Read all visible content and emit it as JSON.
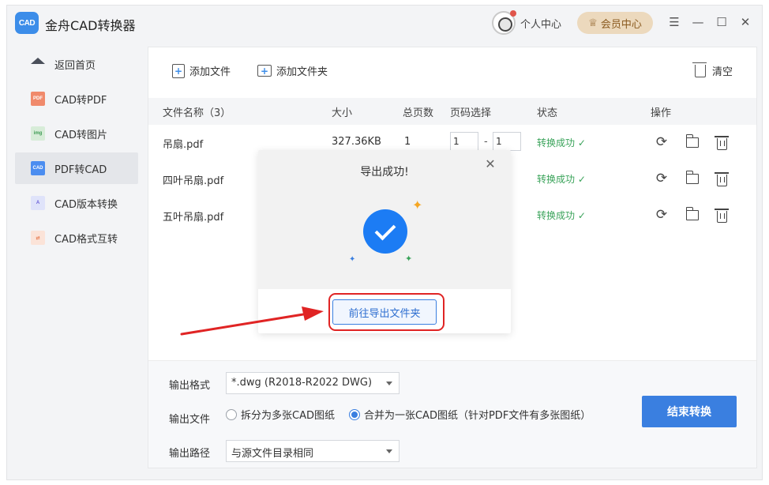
{
  "app": {
    "title": "金舟CAD转换器",
    "logo_text": "CAD",
    "user_center": "个人中心",
    "vip": "会员中心",
    "controls": {
      "menu": "☰",
      "minimize": "—",
      "maximize": "☐",
      "close": "✕"
    }
  },
  "sidebar": {
    "items": [
      {
        "label": "返回首页",
        "icon": "home-icon",
        "badge": ""
      },
      {
        "label": "CAD转PDF",
        "icon": "pdf-icon",
        "badge": "PDF"
      },
      {
        "label": "CAD转图片",
        "icon": "image-icon",
        "badge": "img"
      },
      {
        "label": "PDF转CAD",
        "icon": "cad-icon",
        "badge": "CAD"
      },
      {
        "label": "CAD版本转换",
        "icon": "version-icon",
        "badge": "A"
      },
      {
        "label": "CAD格式互转",
        "icon": "format-icon",
        "badge": "⇄"
      }
    ],
    "active_index": 3
  },
  "toolbar": {
    "add_file": "添加文件",
    "add_folder": "添加文件夹",
    "clear": "清空"
  },
  "table": {
    "headers": {
      "name": "文件名称（3）",
      "size": "大小",
      "pages": "总页数",
      "page_select": "页码选择",
      "status": "状态",
      "ops": "操作"
    },
    "rows": [
      {
        "name": "吊扇.pdf",
        "size": "327.36KB",
        "pages": "1",
        "from": "1",
        "to": "1",
        "status": "转换成功 ✓"
      },
      {
        "name": "四叶吊扇.pdf",
        "size": "",
        "pages": "",
        "from": "",
        "to": "",
        "status": "转换成功 ✓"
      },
      {
        "name": "五叶吊扇.pdf",
        "size": "",
        "pages": "",
        "from": "",
        "to": "",
        "status": "转换成功 ✓"
      }
    ],
    "dash": "-"
  },
  "settings": {
    "format_label": "输出格式",
    "format_value": "*.dwg (R2018-R2022 DWG)",
    "file_label": "输出文件",
    "option_split": "拆分为多张CAD图纸",
    "option_merge": "合并为一张CAD图纸（针对PDF文件有多张图纸）",
    "merge_selected": true,
    "path_label": "输出路径",
    "path_value": "与源文件目录相同",
    "end_button": "结束转换"
  },
  "modal": {
    "title": "导出成功!",
    "button": "前往导出文件夹",
    "close": "✕"
  },
  "colors": {
    "accent": "#3a7fe0",
    "success": "#3aa35a",
    "highlight": "#e02424",
    "vip_bg": "#ecd9bd"
  }
}
